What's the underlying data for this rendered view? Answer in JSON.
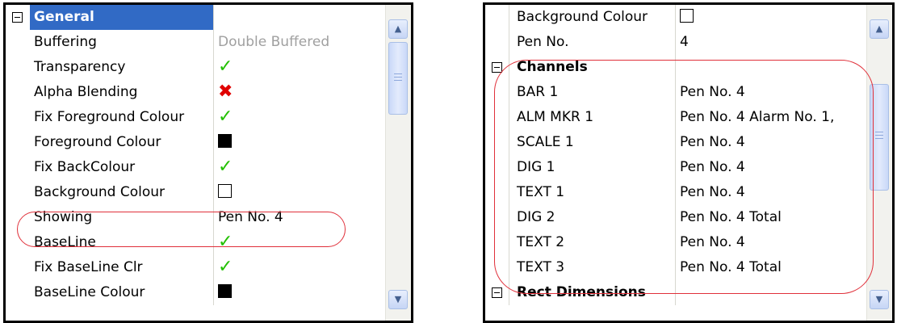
{
  "left_grid": {
    "rows": [
      {
        "kind": "category",
        "label": "General",
        "value": "",
        "selected": true
      },
      {
        "kind": "property",
        "label": "Buffering",
        "value": "Double Buffered",
        "grey": true
      },
      {
        "kind": "property",
        "label": "Transparency",
        "icon": "checkmark-icon",
        "glyph": "✓"
      },
      {
        "kind": "property",
        "label": "Alpha Blending",
        "icon": "cross-icon",
        "glyph": "✖"
      },
      {
        "kind": "property",
        "label": "Fix Foreground Colour",
        "icon": "checkmark-icon",
        "glyph": "✓"
      },
      {
        "kind": "property",
        "label": "Foreground Colour",
        "swatch": "#000000"
      },
      {
        "kind": "property",
        "label": "Fix BackColour",
        "icon": "checkmark-icon",
        "glyph": "✓"
      },
      {
        "kind": "property",
        "label": "Background Colour",
        "swatch": "#ffffff"
      },
      {
        "kind": "property",
        "label": "Showing",
        "value": "Pen No. 4"
      },
      {
        "kind": "property",
        "label": "BaseLine",
        "icon": "checkmark-icon",
        "glyph": "✓"
      },
      {
        "kind": "property",
        "label": "Fix BaseLine Clr",
        "icon": "checkmark-icon",
        "glyph": "✓"
      },
      {
        "kind": "property",
        "label": "BaseLine Colour",
        "swatch": "#000000"
      }
    ],
    "scroll_up_glyph": "▲",
    "scroll_down_glyph": "▼",
    "scroll_position": 0.0
  },
  "right_grid": {
    "rows": [
      {
        "kind": "property",
        "label": "Background Colour",
        "swatch": "#ffffff"
      },
      {
        "kind": "property",
        "label": "Pen No.",
        "value": "4"
      },
      {
        "kind": "category",
        "label": "Channels",
        "value": ""
      },
      {
        "kind": "property",
        "label": "BAR 1",
        "value": "Pen No. 4"
      },
      {
        "kind": "property",
        "label": "ALM MKR 1",
        "value": "Pen No. 4 Alarm No.  1,"
      },
      {
        "kind": "property",
        "label": "SCALE 1",
        "value": "Pen No. 4"
      },
      {
        "kind": "property",
        "label": "DIG 1",
        "value": "Pen No. 4"
      },
      {
        "kind": "property",
        "label": "TEXT 1",
        "value": "Pen No. 4"
      },
      {
        "kind": "property",
        "label": "DIG 2",
        "value": "Pen No. 4 Total"
      },
      {
        "kind": "property",
        "label": "TEXT 2",
        "value": "Pen No. 4"
      },
      {
        "kind": "property",
        "label": "TEXT 3",
        "value": "Pen No. 4 Total"
      },
      {
        "kind": "category",
        "label": "Rect Dimensions",
        "value": ""
      }
    ],
    "scroll_up_glyph": "▲",
    "scroll_down_glyph": "▼",
    "scroll_position": 0.45
  },
  "colors": {
    "selection": "#316ac5",
    "checkmark": "#22c000",
    "cross": "#e00000",
    "highlight": "#e0303a"
  }
}
